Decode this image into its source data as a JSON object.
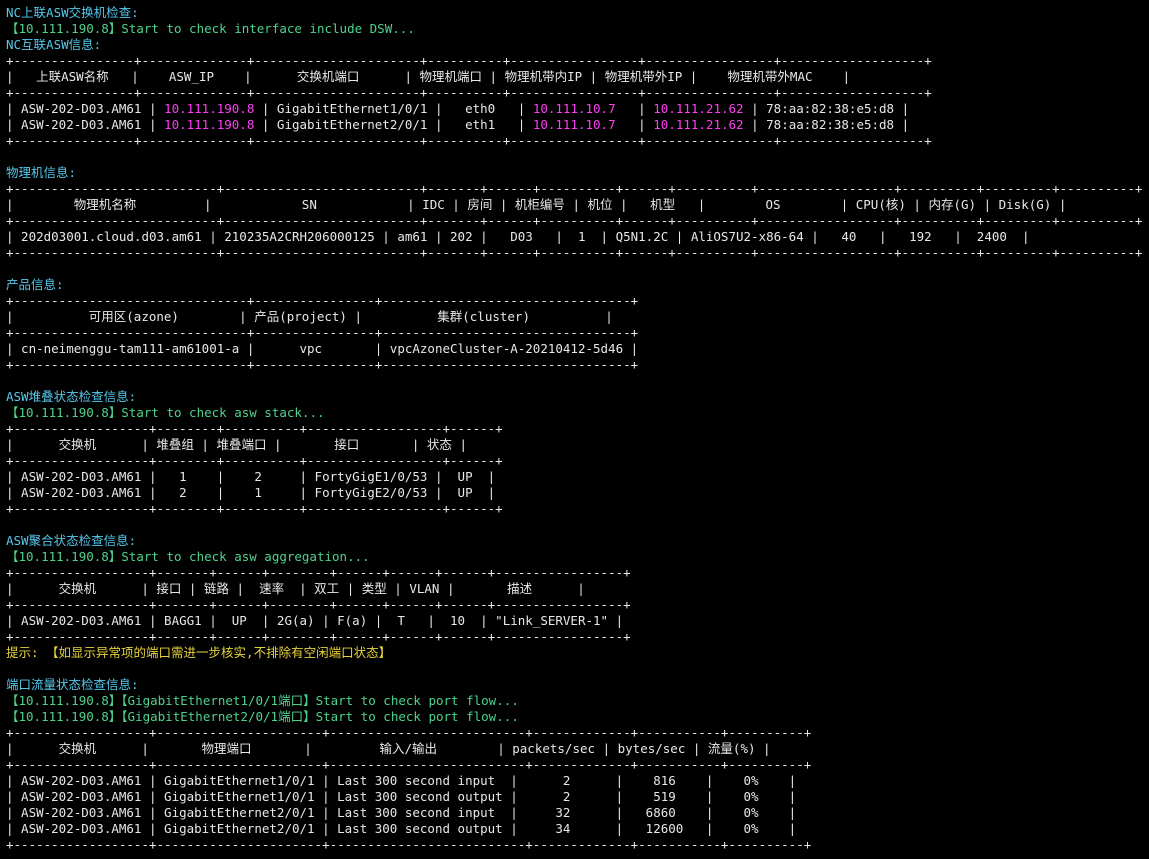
{
  "colors": {
    "bg": "#000000",
    "text": "#e8e8e8",
    "heading": "#56c8ec",
    "info": "#4fd28c",
    "ip": "#ff3df2",
    "hint": "#e6d23a"
  },
  "lines": [
    {
      "name": "line-01",
      "segs": [
        [
          "cy",
          "NC上联ASW交换机检查:"
        ]
      ]
    },
    {
      "name": "line-02",
      "segs": [
        [
          "gr",
          "【10.111.190.8】Start to check interface include DSW..."
        ]
      ]
    },
    {
      "name": "line-03",
      "segs": [
        [
          "cy",
          "NC互联ASW信息:"
        ]
      ]
    },
    {
      "name": "line-04",
      "segs": [
        [
          "wt",
          "+----------------+--------------+----------------------+----------+-----------------+-----------------+-------------------+"
        ]
      ]
    },
    {
      "name": "line-05",
      "segs": [
        [
          "wt",
          "|   上联ASW名称   |    ASW_IP    |      交换机端口      | 物理机端口 | 物理机带内IP | 物理机带外IP |    物理机带外MAC    |"
        ]
      ]
    },
    {
      "name": "line-06",
      "segs": [
        [
          "wt",
          "+----------------+--------------+----------------------+----------+-----------------+-----------------+-------------------+"
        ]
      ]
    },
    {
      "name": "line-07",
      "segs": [
        [
          "wt",
          "| ASW-202-D03.AM61 | "
        ],
        [
          "mg",
          "10.111.190.8"
        ],
        [
          "wt",
          " | GigabitEthernet1/0/1 |   eth0   | "
        ],
        [
          "mg",
          "10.111.10.7"
        ],
        [
          "wt",
          "   | "
        ],
        [
          "mg",
          "10.111.21.62"
        ],
        [
          "wt",
          " | 78:aa:82:38:e5:d8 |"
        ]
      ]
    },
    {
      "name": "line-08",
      "segs": [
        [
          "wt",
          "| ASW-202-D03.AM61 | "
        ],
        [
          "mg",
          "10.111.190.8"
        ],
        [
          "wt",
          " | GigabitEthernet2/0/1 |   eth1   | "
        ],
        [
          "mg",
          "10.111.10.7"
        ],
        [
          "wt",
          "   | "
        ],
        [
          "mg",
          "10.111.21.62"
        ],
        [
          "wt",
          " | 78:aa:82:38:e5:d8 |"
        ]
      ]
    },
    {
      "name": "line-09",
      "segs": [
        [
          "wt",
          "+----------------+--------------+----------------------+----------+-----------------+-----------------+-------------------+"
        ]
      ]
    },
    {
      "name": "line-10",
      "segs": [
        [
          "wt",
          ""
        ]
      ]
    },
    {
      "name": "line-11",
      "segs": [
        [
          "cy",
          "物理机信息:"
        ]
      ]
    },
    {
      "name": "line-12",
      "segs": [
        [
          "wt",
          "+---------------------------+--------------------------+-------+------+----------+------+----------+------------------+----------+---------+----------+"
        ]
      ]
    },
    {
      "name": "line-13",
      "segs": [
        [
          "wt",
          "|        物理机名称         |            SN            | IDC | 房间 | 机柜编号 | 机位 |   机型   |        OS        | CPU(核) | 内存(G) | Disk(G) |"
        ]
      ]
    },
    {
      "name": "line-14",
      "segs": [
        [
          "wt",
          "+---------------------------+--------------------------+-------+------+----------+------+----------+------------------+----------+---------+----------+"
        ]
      ]
    },
    {
      "name": "line-15",
      "segs": [
        [
          "wt",
          "| 202d03001.cloud.d03.am61 | 210235A2CRH206000125 | am61 | 202 |   D03   |  1  | Q5N1.2C | AliOS7U2-x86-64 |   40   |   192   |  2400  |"
        ]
      ]
    },
    {
      "name": "line-16",
      "segs": [
        [
          "wt",
          "+---------------------------+--------------------------+-------+------+----------+------+----------+------------------+----------+---------+----------+"
        ]
      ]
    },
    {
      "name": "line-17",
      "segs": [
        [
          "wt",
          ""
        ]
      ]
    },
    {
      "name": "line-18",
      "segs": [
        [
          "cy",
          "产品信息:"
        ]
      ]
    },
    {
      "name": "line-19",
      "segs": [
        [
          "wt",
          "+-------------------------------+----------------+---------------------------------+"
        ]
      ]
    },
    {
      "name": "line-20",
      "segs": [
        [
          "wt",
          "|          可用区(azone)        | 产品(project) |          集群(cluster)          |"
        ]
      ]
    },
    {
      "name": "line-21",
      "segs": [
        [
          "wt",
          "+-------------------------------+----------------+---------------------------------+"
        ]
      ]
    },
    {
      "name": "line-22",
      "segs": [
        [
          "wt",
          "| cn-neimenggu-tam111-am61001-a |      vpc       | vpcAzoneCluster-A-20210412-5d46 |"
        ]
      ]
    },
    {
      "name": "line-23",
      "segs": [
        [
          "wt",
          "+-------------------------------+----------------+---------------------------------+"
        ]
      ]
    },
    {
      "name": "line-24",
      "segs": [
        [
          "wt",
          ""
        ]
      ]
    },
    {
      "name": "line-25",
      "segs": [
        [
          "cy",
          "ASW堆叠状态检查信息:"
        ]
      ]
    },
    {
      "name": "line-26",
      "segs": [
        [
          "gr",
          "【10.111.190.8】Start to check asw stack..."
        ]
      ]
    },
    {
      "name": "line-27",
      "segs": [
        [
          "wt",
          "+------------------+--------+----------+------------------+------+"
        ]
      ]
    },
    {
      "name": "line-28",
      "segs": [
        [
          "wt",
          "|      交换机      | 堆叠组 | 堆叠端口 |       接口       | 状态 |"
        ]
      ]
    },
    {
      "name": "line-29",
      "segs": [
        [
          "wt",
          "+------------------+--------+----------+------------------+------+"
        ]
      ]
    },
    {
      "name": "line-30",
      "segs": [
        [
          "wt",
          "| ASW-202-D03.AM61 |   1    |    2     | FortyGigE1/0/53 |  UP  |"
        ]
      ]
    },
    {
      "name": "line-31",
      "segs": [
        [
          "wt",
          "| ASW-202-D03.AM61 |   2    |    1     | FortyGigE2/0/53 |  UP  |"
        ]
      ]
    },
    {
      "name": "line-32",
      "segs": [
        [
          "wt",
          "+------------------+--------+----------+------------------+------+"
        ]
      ]
    },
    {
      "name": "line-33",
      "segs": [
        [
          "wt",
          ""
        ]
      ]
    },
    {
      "name": "line-34",
      "segs": [
        [
          "cy",
          "ASW聚合状态检查信息:"
        ]
      ]
    },
    {
      "name": "line-35",
      "segs": [
        [
          "gr",
          "【10.111.190.8】Start to check asw aggregation..."
        ]
      ]
    },
    {
      "name": "line-36",
      "segs": [
        [
          "wt",
          "+------------------+-------+------+--------+------+------+------+-----------------+"
        ]
      ]
    },
    {
      "name": "line-37",
      "segs": [
        [
          "wt",
          "|      交换机      | 接口 | 链路 |  速率  | 双工 | 类型 | VLAN |       描述      |"
        ]
      ]
    },
    {
      "name": "line-38",
      "segs": [
        [
          "wt",
          "+------------------+-------+------+--------+------+------+------+-----------------+"
        ]
      ]
    },
    {
      "name": "line-39",
      "segs": [
        [
          "wt",
          "| ASW-202-D03.AM61 | BAGG1 |  UP  | 2G(a) | F(a) |  T   |  10  | \"Link_SERVER-1\" |"
        ]
      ]
    },
    {
      "name": "line-40",
      "segs": [
        [
          "wt",
          "+------------------+-------+------+--------+------+------+------+-----------------+"
        ]
      ]
    },
    {
      "name": "line-41",
      "segs": [
        [
          "yl",
          "提示: 【如显示异常项的端口需进一步核实,不排除有空闲端口状态】"
        ]
      ]
    },
    {
      "name": "line-42",
      "segs": [
        [
          "wt",
          ""
        ]
      ]
    },
    {
      "name": "line-43",
      "segs": [
        [
          "cy",
          "端口流量状态检查信息:"
        ]
      ]
    },
    {
      "name": "line-44",
      "segs": [
        [
          "gr",
          "【10.111.190.8】【GigabitEthernet1/0/1端口】Start to check port flow..."
        ]
      ]
    },
    {
      "name": "line-45",
      "segs": [
        [
          "gr",
          "【10.111.190.8】【GigabitEthernet2/0/1端口】Start to check port flow..."
        ]
      ]
    },
    {
      "name": "line-46",
      "segs": [
        [
          "wt",
          "+------------------+----------------------+--------------------------+-------------+-----------+----------+"
        ]
      ]
    },
    {
      "name": "line-47",
      "segs": [
        [
          "wt",
          "|      交换机      |       物理端口       |         输入/输出        | packets/sec | bytes/sec | 流量(%) |"
        ]
      ]
    },
    {
      "name": "line-48",
      "segs": [
        [
          "wt",
          "+------------------+----------------------+--------------------------+-------------+-----------+----------+"
        ]
      ]
    },
    {
      "name": "line-49",
      "segs": [
        [
          "wt",
          "| ASW-202-D03.AM61 | GigabitEthernet1/0/1 | Last 300 second input  |      2      |    816    |    0%    |"
        ]
      ]
    },
    {
      "name": "line-50",
      "segs": [
        [
          "wt",
          "| ASW-202-D03.AM61 | GigabitEthernet1/0/1 | Last 300 second output |      2      |    519    |    0%    |"
        ]
      ]
    },
    {
      "name": "line-51",
      "segs": [
        [
          "wt",
          "| ASW-202-D03.AM61 | GigabitEthernet2/0/1 | Last 300 second input  |     32      |   6860    |    0%    |"
        ]
      ]
    },
    {
      "name": "line-52",
      "segs": [
        [
          "wt",
          "| ASW-202-D03.AM61 | GigabitEthernet2/0/1 | Last 300 second output |     34      |   12600   |    0%    |"
        ]
      ]
    },
    {
      "name": "line-53",
      "segs": [
        [
          "wt",
          "+------------------+----------------------+--------------------------+-------------+-----------+----------+"
        ]
      ]
    }
  ]
}
